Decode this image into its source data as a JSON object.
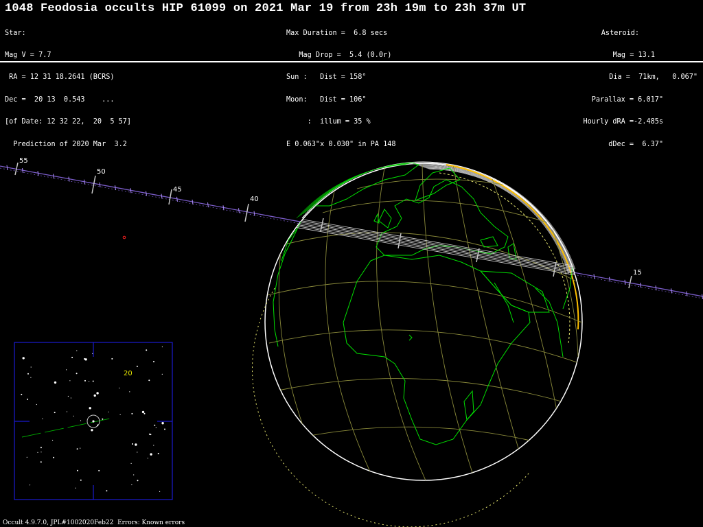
{
  "title": "1048 Feodosia occults HIP 61099 on 2021 Mar 19 from 23h 19m to 23h 37m UT",
  "star_info": [
    "Star:",
    "Mag V = 7.7",
    " RA = 12 31 18.2641 (BCRS)",
    "Dec =  20 13  0.543    ...",
    "[of Date: 12 32 22,  20  5 57]",
    "  Prediction of 2020 Mar  3.2"
  ],
  "event_info": [
    "Max Duration =  6.8 secs",
    "   Mag Drop =  5.4 (0.0r)",
    "Sun :   Dist = 158°",
    "Moon:   Dist = 106°",
    "     :  illum = 35 %",
    "E 0.063\"x 0.030\" in PA 148"
  ],
  "asteroid_info": [
    "Asteroid:",
    "Mag = 13.1",
    "Dia =  71km,   0.067\"",
    "Parallax = 6.017\"",
    "Hourly dRA =-2.485s",
    "dDec =  6.37\""
  ],
  "path_tick_labels": [
    "55",
    "50",
    "45",
    "40",
    "15"
  ],
  "starchart_label": "20",
  "footer": "Occult 4.9.7.0, JPL#1002020Feb22  Errors: Known errors",
  "colors": {
    "background": "#000000",
    "coastline": "#00e000",
    "graticule": "#8a8a3a",
    "path_line": "#7a5cc8",
    "shadow_band": "#d8d8d8",
    "limb_sun": "#ffc000",
    "limb_rise": "#e8e870",
    "chart_frame": "#1a1ad0",
    "chart_label": "#e8e800",
    "miss_marker": "#ff2020"
  }
}
